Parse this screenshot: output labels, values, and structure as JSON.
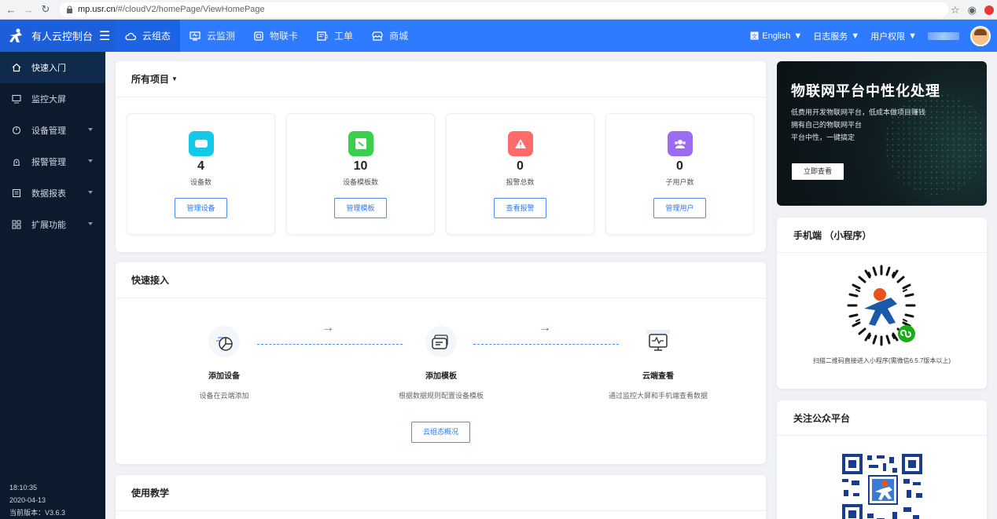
{
  "browser": {
    "url_host": "mp.usr.cn",
    "url_path": "/#/cloudV2/homePage/ViewHomePage"
  },
  "header": {
    "brand_title": "有人云控制台",
    "nav": [
      {
        "label": "云组态",
        "icon": "cloud-icon"
      },
      {
        "label": "云监测",
        "icon": "monitor-icon"
      },
      {
        "label": "物联卡",
        "icon": "sim-card-icon"
      },
      {
        "label": "工单",
        "icon": "ticket-icon"
      },
      {
        "label": "商城",
        "icon": "store-icon"
      }
    ],
    "language": "English",
    "log_service": "日志服务",
    "user_permission": "用户权限"
  },
  "sidebar": {
    "items": [
      {
        "label": "快速入门",
        "icon": "home-icon",
        "active": true
      },
      {
        "label": "监控大屏",
        "icon": "monitor-icon"
      },
      {
        "label": "设备管理",
        "icon": "device-icon",
        "has_children": true
      },
      {
        "label": "报警管理",
        "icon": "alarm-icon",
        "has_children": true
      },
      {
        "label": "数据报表",
        "icon": "report-icon",
        "has_children": true
      },
      {
        "label": "扩展功能",
        "icon": "extension-icon",
        "has_children": true
      }
    ],
    "time": "18:10:35",
    "date": "2020-04-13",
    "version": "当前版本：V3.6.3"
  },
  "projects": {
    "title": "所有项目",
    "stats": [
      {
        "value": "4",
        "label": "设备数",
        "button": "管理设备",
        "color": "#12c9ea"
      },
      {
        "value": "10",
        "label": "设备模板数",
        "button": "管理模板",
        "color": "#3ccf4e"
      },
      {
        "value": "0",
        "label": "报警总数",
        "button": "查看报警",
        "color": "#ff6b6b"
      },
      {
        "value": "0",
        "label": "子用户数",
        "button": "管理用户",
        "color": "#9b6bf2"
      }
    ]
  },
  "quick": {
    "title": "快速接入",
    "steps": [
      {
        "title": "添加设备",
        "desc": "设备在云端添加"
      },
      {
        "title": "添加模板",
        "desc": "根据数据规则配置设备模板"
      },
      {
        "title": "云端查看",
        "desc": "通过监控大屏和手机端查看数据"
      }
    ],
    "overview_button": "云组态概况"
  },
  "tutorial": {
    "title": "使用教学"
  },
  "banner": {
    "title": "物联网平台中性化处理",
    "lines": [
      "低费用开发物联网平台，低成本做项目赚钱",
      "拥有自己的物联网平台",
      "平台中性，一键搞定"
    ],
    "button": "立即查看"
  },
  "mobile": {
    "title": "手机端 （小程序）",
    "caption": "扫描二维码直接进入小程序(需微信6.5.7版本以上)"
  },
  "wechat": {
    "title": "关注公众平台"
  },
  "colors": {
    "primary": "#2f7bff",
    "sidebar": "#0c1a2e"
  }
}
